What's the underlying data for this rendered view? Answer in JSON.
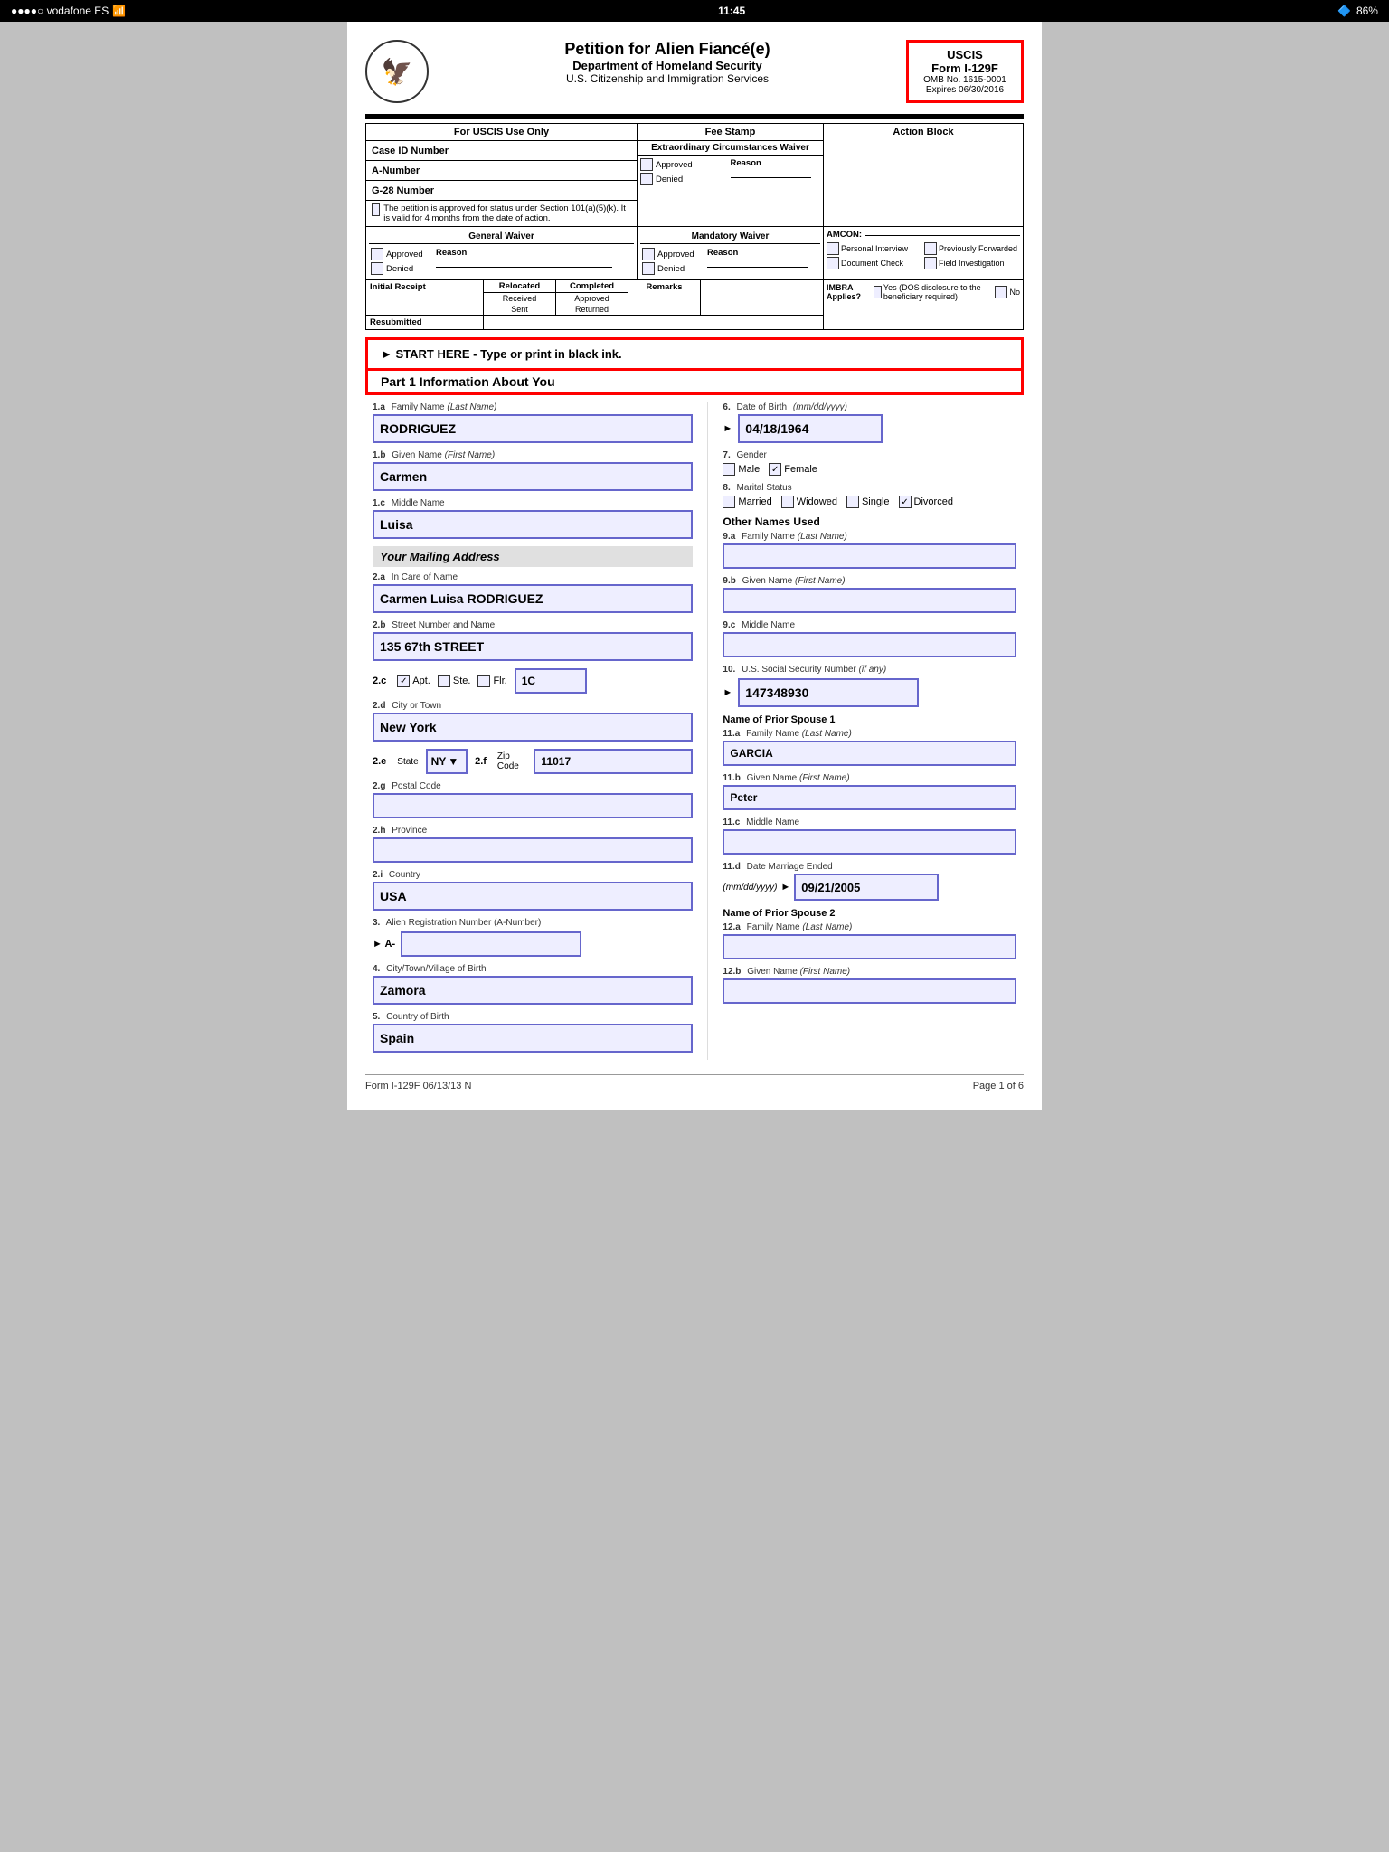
{
  "statusBar": {
    "carrier": "●●●●○ vodafone ES",
    "wifi": "WiFi",
    "time": "11:45",
    "bluetooth": "BT",
    "battery": "86%"
  },
  "header": {
    "title": "Petition for Alien Fiancé(e)",
    "subtitle": "Department of Homeland Security",
    "subtitle2": "U.S. Citizenship and Immigration Services",
    "uscis": {
      "label": "USCIS",
      "form": "Form I-129F",
      "omb": "OMB No. 1615-0001",
      "expires": "Expires 06/30/2016"
    }
  },
  "topSection": {
    "forUscisLabel": "For USCIS Use Only",
    "feeStampLabel": "Fee Stamp",
    "actionBlockLabel": "Action Block",
    "caseIdLabel": "Case ID Number",
    "aNumberLabel": "A-Number",
    "g28Label": "G-28 Number",
    "petitionText": "The petition is approved for status under Section 101(a)(5)(k). It is valid for 4 months from the date of action.",
    "circWaiverTitle": "Extraordinary Circumstances Waiver",
    "approvedLabel": "Approved",
    "deniedLabel": "Denied",
    "reasonLabel": "Reason",
    "genWaiverTitle": "General Waiver",
    "mandWaiverTitle": "Mandatory Waiver",
    "amconLabel": "AMCON:",
    "personalInterviewLabel": "Personal Interview",
    "prevForwardedLabel": "Previously Forwarded",
    "docCheckLabel": "Document Check",
    "fieldInvestLabel": "Field Investigation",
    "imbraLabel": "IMBRA Applies?",
    "imbraYesLabel": "Yes (DOS disclosure to the beneficiary required)",
    "imbraNoLabel": "No",
    "initialReceiptLabel": "Initial Receipt",
    "resubmittedLabel": "Resubmitted",
    "relocatedLabel": "Relocated",
    "receivedLabel": "Received",
    "sentLabel": "Sent",
    "completedLabel": "Completed",
    "approvedLabel2": "Approved",
    "returnedLabel": "Returned",
    "remarksLabel": "Remarks"
  },
  "startHere": {
    "text": "► START HERE - Type or print in black ink."
  },
  "part1": {
    "header": "Part 1    Information About You"
  },
  "fields": {
    "1a": {
      "num": "1.a",
      "label": "Family Name",
      "sublabel": "(Last Name)",
      "value": "RODRIGUEZ"
    },
    "1b": {
      "num": "1.b",
      "label": "Given Name",
      "sublabel": "(First Name)",
      "value": "Carmen"
    },
    "1c": {
      "num": "1.c",
      "label": "Middle Name",
      "value": "Luisa"
    },
    "mailingAddress": {
      "label": "Your Mailing Address"
    },
    "2a": {
      "num": "2.a",
      "label": "In Care of Name",
      "value": "Carmen Luisa RODRIGUEZ"
    },
    "2b": {
      "num": "2.b",
      "label": "Street Number and Name",
      "value": "135 67th STREET"
    },
    "2c": {
      "num": "2.c",
      "label": "Apt.",
      "aptChecked": true,
      "ste": "Ste.",
      "steChecked": false,
      "flr": "Flr.",
      "flrChecked": false,
      "value": "1C"
    },
    "2d": {
      "num": "2.d",
      "label": "City or Town",
      "value": "New York"
    },
    "2e": {
      "num": "2.e",
      "label": "State",
      "value": "NY"
    },
    "2f": {
      "num": "2.f",
      "label": "Zip Code",
      "value": "11017"
    },
    "2g": {
      "num": "2.g",
      "label": "Postal Code",
      "value": ""
    },
    "2h": {
      "num": "2.h",
      "label": "Province",
      "value": ""
    },
    "2i": {
      "num": "2.i",
      "label": "Country",
      "value": "USA"
    },
    "3": {
      "num": "3.",
      "label": "Alien Registration Number (A-Number)",
      "prefix": "► A-",
      "value": ""
    },
    "4": {
      "num": "4.",
      "label": "City/Town/Village of Birth",
      "value": "Zamora"
    },
    "5": {
      "num": "5.",
      "label": "Country of Birth",
      "value": "Spain"
    },
    "6": {
      "num": "6.",
      "label": "Date of Birth",
      "sublabel": "(mm/dd/yyyy)",
      "value": "04/18/1964"
    },
    "7": {
      "num": "7.",
      "label": "Gender",
      "maleChecked": false,
      "femaleChecked": true
    },
    "8": {
      "num": "8.",
      "label": "Marital Status",
      "marriedChecked": false,
      "widowedChecked": false,
      "singleChecked": false,
      "divorcedChecked": true
    },
    "9a": {
      "num": "9.a",
      "label": "Family Name",
      "sublabel": "(Last Name)",
      "value": ""
    },
    "9b": {
      "num": "9.b",
      "label": "Given Name",
      "sublabel": "(First Name)",
      "value": ""
    },
    "9c": {
      "num": "9.c",
      "label": "Middle Name",
      "value": ""
    },
    "10": {
      "num": "10.",
      "label": "U.S. Social Security Number",
      "sublabel": "(if any)",
      "prefix": "►",
      "value": "147348930"
    },
    "priorSpouse1": {
      "label": "Name of Prior Spouse 1"
    },
    "11a": {
      "num": "11.a",
      "label": "Family Name",
      "sublabel": "(Last Name)",
      "value": "GARCIA"
    },
    "11b": {
      "num": "11.b",
      "label": "Given Name",
      "sublabel": "(First Name)",
      "value": "Peter"
    },
    "11c": {
      "num": "11.c",
      "label": "Middle Name",
      "value": ""
    },
    "11d": {
      "num": "11.d",
      "label": "Date Marriage Ended",
      "sublabel": "(mm/dd/yyyy)",
      "prefix": "►",
      "value": "09/21/2005"
    },
    "priorSpouse2": {
      "label": "Name of Prior Spouse 2"
    },
    "12a": {
      "num": "12.a",
      "label": "Family Name",
      "sublabel": "(Last Name)",
      "value": ""
    },
    "12b": {
      "num": "12.b",
      "label": "Given Name",
      "sublabel": "(First Name)",
      "value": ""
    }
  },
  "otherNamesLabel": "Other Names Used",
  "footer": {
    "left": "Form I-129F  06/13/13 N",
    "right": "Page 1 of 6"
  }
}
